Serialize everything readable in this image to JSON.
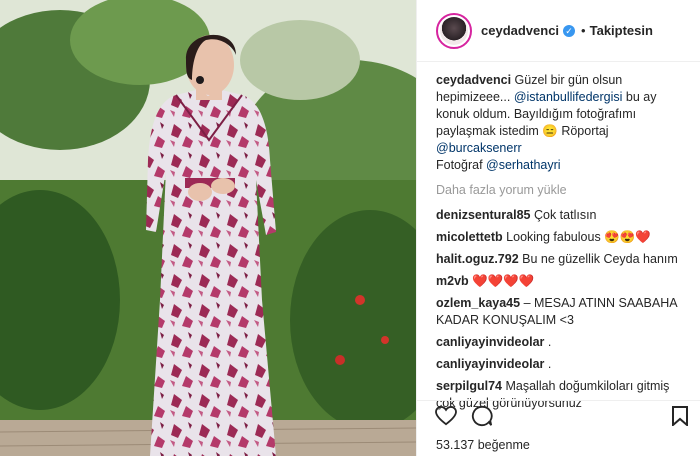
{
  "post": {
    "username": "ceydadvenci",
    "follow_status": "Takiptesin",
    "caption": {
      "t1": "Güzel bir gün olsun hepimizeee... ",
      "mention1": "@istanbullifedergisi",
      "t2": " bu ay konuk oldum. Bayıldığım fotoğrafımı paylaşmak istedim 😑 Röportaj ",
      "mention2": "@burcaksenerr",
      "t3": "Fotoğraf ",
      "mention3": "@serhathayri"
    },
    "load_more": "Daha fazla yorum yükle",
    "comments": [
      {
        "user": "denizsentural85",
        "text": "Çok tatlısın"
      },
      {
        "user": "micolettetb",
        "text": "Looking fabulous 😍😍❤️"
      },
      {
        "user": "halit.oguz.792",
        "text": "Bu ne güzellik Ceyda hanım"
      },
      {
        "user": "m2vb",
        "text": "❤️❤️❤️❤️"
      },
      {
        "user": "ozlem_kaya45",
        "text": "– MESAJ ATINN SAABAHA KADAR KONUŞALIM <3"
      },
      {
        "user": "canliyayinvideolar",
        "text": "."
      },
      {
        "user": "canliyayinvideolar",
        "text": "."
      },
      {
        "user": "serpilgul74",
        "text": "Maşallah doğumkiloları gitmiş çok güzel görünüyorsunuz"
      }
    ],
    "likes": "53.137 beğenme",
    "icons": [
      "heart-icon",
      "comment-icon",
      "bookmark-icon",
      "verified-badge-icon"
    ],
    "colors": {
      "mention": "#003569",
      "verified": "#3897f0",
      "dress": "#9c2a55"
    }
  }
}
